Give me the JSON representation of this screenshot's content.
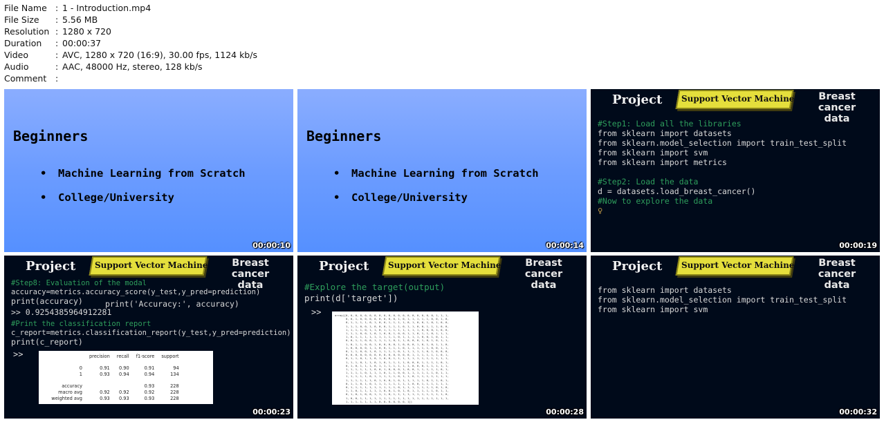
{
  "metadata": {
    "rows": [
      {
        "key": "File Name",
        "value": "1 - Introduction.mp4"
      },
      {
        "key": "File Size",
        "value": "5.56 MB"
      },
      {
        "key": "Resolution",
        "value": "1280 x 720"
      },
      {
        "key": "Duration",
        "value": "00:00:37"
      },
      {
        "key": "Video",
        "value": "AVC, 1280 x 720 (16:9), 30.00 fps, 1124 kb/s"
      },
      {
        "key": "Audio",
        "value": "AAC, 48000 Hz, stereo, 128 kb/s"
      },
      {
        "key": "Comment",
        "value": ""
      }
    ],
    "separator": ":"
  },
  "common": {
    "project": "Project",
    "svm": "Support Vector Machine",
    "bcd_line1": "Breast cancer",
    "bcd_line2": "data",
    "bullet": "•",
    "prompt": ">>"
  },
  "frames": [
    {
      "timestamp": "00:00:10",
      "heading": "Beginners",
      "bullets": [
        "Machine Learning from Scratch",
        "College/University"
      ]
    },
    {
      "timestamp": "00:00:14",
      "heading": "Beginners",
      "bullets": [
        "Machine Learning from Scratch",
        "College/University"
      ]
    },
    {
      "timestamp": "00:00:19",
      "lines": [
        "#Step1: Load all the libraries",
        "from sklearn import datasets",
        "from sklearn.model_selection import train_test_split",
        "from sklearn import svm",
        "from sklearn import metrics",
        "#Step2: Load the data",
        "d = datasets.load_breast_cancer()",
        "#Now to explore the data"
      ],
      "cursor": "♀"
    },
    {
      "timestamp": "00:00:23",
      "lines": [
        "#Step8: Evaluation of the modal",
        "accuracy=metrics.accuracy_score(y_test,y_pred=prediction)",
        "print(accuracy)",
        "print('Accuracy:', accuracy)",
        ">> 0.9254385964912281",
        "#Print the classification report",
        "c_report=metrics.classification_report(y_test,y_pred=prediction)",
        "print(c_report)"
      ],
      "report": {
        "header": [
          "",
          "precision",
          "recall",
          "f1-score",
          "support"
        ],
        "rows": [
          [
            "0",
            "0.91",
            "0.90",
            "0.91",
            "94"
          ],
          [
            "1",
            "0.93",
            "0.94",
            "0.94",
            "134"
          ],
          [
            "accuracy",
            "",
            "",
            "0.93",
            "228"
          ],
          [
            "macro avg",
            "0.92",
            "0.92",
            "0.92",
            "228"
          ],
          [
            "weighted avg",
            "0.93",
            "0.93",
            "0.93",
            "228"
          ]
        ]
      }
    },
    {
      "timestamp": "00:00:28",
      "lines": [
        "#Explore the target(output)",
        "print(d['target'])"
      ],
      "array_first": "array([0, 0, 0, 0, 0, 0, 0, 0, 0, 0, 0, 0, 0, 0, 0, 0, 0, 0, 0, 1, 1, 1,",
      "array_rows": [
        "       0, 0, 1, 0, 0, 0, 0, 0, 0, 0, 0, 1, 0, 1, 1, 1, 1, 1, 0, 0, 1, 0,",
        "       0, 1, 1, 1, 1, 0, 1, 0, 0, 1, 1, 1, 1, 0, 1, 0, 0, 1, 0, 1, 0, 0,",
        "       1, 1, 1, 0, 0, 1, 0, 0, 0, 1, 1, 1, 0, 1, 1, 0, 0, 1, 1, 1, 0, 0,",
        "       1, 1, 1, 1, 0, 1, 1, 0, 1, 1, 1, 1, 1, 1, 1, 1, 0, 0, 0, 1, 0, 0,",
        "       1, 1, 1, 0, 0, 1, 0, 1, 0, 0, 1, 0, 0, 1, 1, 0, 1, 1, 0, 1, 1, 1,",
        "       1, 0, 1, 1, 1, 1, 1, 1, 1, 1, 1, 0, 1, 1, 1, 1, 0, 0, 1, 0, 1, 1,",
        "       0, 0, 1, 1, 0, 0, 1, 1, 1, 1, 0, 1, 1, 0, 0, 0, 1, 0, 1, 0, 1, 1,",
        "       1, 0, 1, 1, 0, 0, 1, 0, 0, 0, 0, 1, 0, 0, 0, 1, 0, 1, 0, 1, 1, 0,",
        "       1, 0, 0, 0, 0, 1, 1, 0, 0, 1, 1, 1, 0, 1, 1, 1, 1, 1, 0, 0, 1, 1,",
        "       0, 1, 1, 0, 0, 1, 0, 1, 1, 1, 1, 0, 1, 1, 1, 1, 1, 0, 1, 0, 0, 0,",
        "       0, 0, 0, 0, 0, 0, 0, 0, 0, 0, 0, 0, 0, 0, 1, 1, 1, 1, 1, 1, 0, 1,",
        "       0, 1, 1, 0, 1, 1, 0, 1, 0, 0, 1, 1, 1, 1, 1, 1, 1, 1, 1, 1, 1, 1,",
        "       1, 1, 1, 0, 1, 1, 0, 1, 0, 1, 1, 1, 1, 0, 0, 0, 1, 1, 1, 1, 0, 1,",
        "       0, 1, 0, 1, 1, 1, 0, 1, 1, 1, 1, 1, 1, 1, 0, 0, 0, 1, 1, 1, 1, 1,",
        "       1, 1, 1, 1, 1, 1, 0, 0, 1, 0, 0, 0, 1, 0, 0, 1, 1, 1, 1, 1, 0, 1,",
        "       1, 1, 1, 1, 0, 1, 1, 1, 0, 1, 1, 0, 0, 1, 1, 1, 1, 1, 1, 0, 1, 1,",
        "       1, 1, 1, 1, 1, 0, 1, 1, 1, 1, 1, 0, 1, 1, 0, 1, 1, 1, 1, 1, 1, 1,",
        "       1, 1, 1, 1, 1, 1, 0, 1, 0, 0, 1, 0, 1, 1, 1, 1, 1, 0, 1, 1, 0, 1,",
        "       0, 1, 1, 0, 1, 0, 1, 1, 1, 1, 1, 1, 1, 1, 0, 0, 1, 1, 1, 1, 1, 1,",
        "       0, 1, 1, 1, 1, 1, 1, 1, 1, 1, 1, 0, 1, 1, 1, 1, 1, 1, 1, 0, 1, 0,",
        "       1, 1, 0, 1, 1, 1, 1, 1, 0, 0, 1, 0, 1, 0, 1, 1, 1, 1, 1, 0, 1, 1,",
        "       0, 1, 0, 1, 0, 0, 1, 1, 1, 0, 1, 1, 1, 1, 1, 1, 1, 1, 1, 1, 1, 0,",
        "       1, 0, 0, 1, 1, 1, 1, 1, 1, 1, 1, 1, 1, 1, 1, 1, 1, 1, 1, 1, 1, 1,",
        "       1, 1, 1, 1, 1, 1, 1, 0, 0, 0, 0, 0, 0, 1])"
      ]
    },
    {
      "timestamp": "00:00:32",
      "lines": [
        "from sklearn import datasets",
        "from sklearn.model_selection import train_test_split",
        "from sklearn import svm"
      ]
    }
  ]
}
